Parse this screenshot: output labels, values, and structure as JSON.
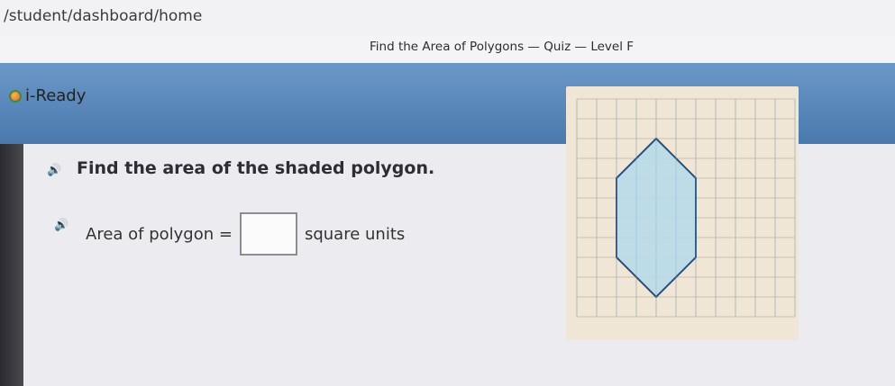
{
  "browser": {
    "url": "/student/dashboard/home"
  },
  "app": {
    "brand": "i-Ready",
    "quiz_title": "Find the Area of Polygons — Quiz — Level F"
  },
  "question": {
    "prompt": "Find the area of the shaded polygon.",
    "answer_prefix": "Area of polygon =",
    "answer_suffix": "square units",
    "answer_value": ""
  },
  "figure": {
    "grid_columns": 11,
    "grid_rows": 11,
    "polygon_vertices": [
      [
        3,
        1
      ],
      [
        5,
        3
      ],
      [
        5,
        7
      ],
      [
        3,
        9
      ],
      [
        1,
        7
      ],
      [
        1,
        3
      ]
    ],
    "fill_color": "#b5d9ea",
    "stroke_color": "#2b4f79",
    "grid_color": "#cdbfa9"
  }
}
